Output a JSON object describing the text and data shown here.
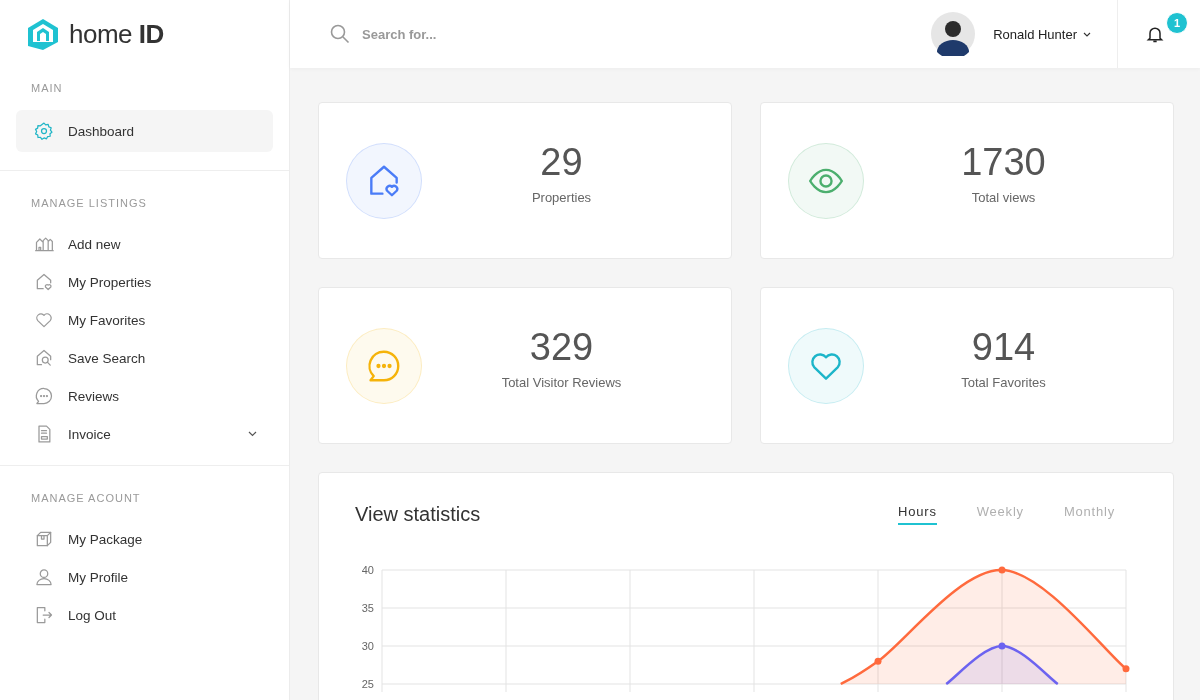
{
  "brand": {
    "name": "home",
    "suffix": "ID"
  },
  "sidebar": {
    "sections": [
      {
        "title": "MAIN",
        "items": [
          {
            "label": "Dashboard",
            "kind": "gear",
            "selected": true,
            "has_submenu": false
          }
        ]
      },
      {
        "title": "MANAGE LISTINGS",
        "items": [
          {
            "label": "Add new",
            "kind": "buildings",
            "selected": false,
            "has_submenu": false
          },
          {
            "label": "My Properties",
            "kind": "house-heart",
            "selected": false,
            "has_submenu": false
          },
          {
            "label": "My Favorites",
            "kind": "heart",
            "selected": false,
            "has_submenu": false
          },
          {
            "label": "Save Search",
            "kind": "house-search",
            "selected": false,
            "has_submenu": false
          },
          {
            "label": "Reviews",
            "kind": "chat",
            "selected": false,
            "has_submenu": false
          },
          {
            "label": "Invoice",
            "kind": "document",
            "selected": false,
            "has_submenu": true
          }
        ]
      },
      {
        "title": "MANAGE ACOUNT",
        "items": [
          {
            "label": "My Package",
            "kind": "box",
            "selected": false,
            "has_submenu": false
          },
          {
            "label": "My Profile",
            "kind": "user",
            "selected": false,
            "has_submenu": false
          },
          {
            "label": "Log Out",
            "kind": "logout",
            "selected": false,
            "has_submenu": false
          }
        ]
      }
    ]
  },
  "header": {
    "search": {
      "placeholder": "Search for..."
    },
    "user": {
      "name": "Ronald Hunter"
    },
    "notifications": {
      "count": "1"
    }
  },
  "stats": [
    {
      "value": "29",
      "label": "Properties",
      "kind": "house-heart",
      "color": "#4a7cf7"
    },
    {
      "value": "1730",
      "label": "Total views",
      "kind": "eye",
      "color": "#4caf6e"
    },
    {
      "value": "329",
      "label": "Total Visitor Reviews",
      "kind": "chat",
      "color": "#f5b30a"
    },
    {
      "value": "914",
      "label": "Total Favorites",
      "kind": "heart",
      "color": "#1cb5c9"
    }
  ],
  "statistics": {
    "title": "View statistics",
    "tabs": [
      {
        "label": "Hours",
        "selected": true
      },
      {
        "label": "Weekly",
        "selected": false
      },
      {
        "label": "Monthly",
        "selected": false
      }
    ],
    "y_axis_labels": [
      "40",
      "35",
      "30",
      "25"
    ]
  }
}
